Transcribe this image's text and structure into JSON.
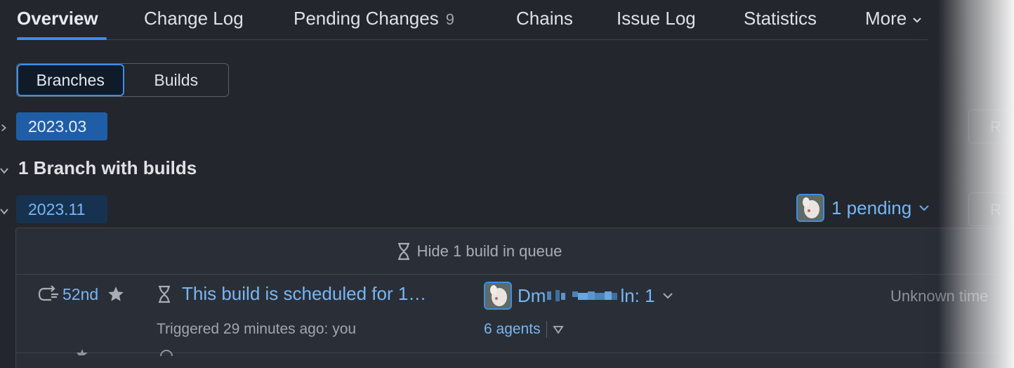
{
  "tabs": [
    {
      "label": "Overview",
      "active": true
    },
    {
      "label": "Change Log"
    },
    {
      "label": "Pending Changes",
      "count": "9"
    },
    {
      "label": "Chains"
    },
    {
      "label": "Issue Log"
    },
    {
      "label": "Statistics"
    },
    {
      "label": "More"
    }
  ],
  "segmented": {
    "branches": "Branches",
    "builds": "Builds",
    "selected": "Branches"
  },
  "branches": {
    "collapsed": {
      "name": "2023.03",
      "action": "R"
    },
    "section_title": "1 Branch with builds",
    "expanded": {
      "name": "2023.11",
      "pending": "1 pending",
      "action": "R"
    }
  },
  "queue": {
    "hide_label": "Hide 1 build in queue"
  },
  "build": {
    "number": "52nd",
    "title": "This build is scheduled for 1…",
    "triggered": "Triggered 29 minutes ago: you",
    "agent_prefix": "Dm",
    "agent_suffix": "ln: 1",
    "agents_link": "6 agents",
    "time": "Unknown time"
  },
  "colors": {
    "accent": "#3b8ee8",
    "link": "#77b6f5",
    "background": "#23262d",
    "panel": "#2a2f37"
  }
}
